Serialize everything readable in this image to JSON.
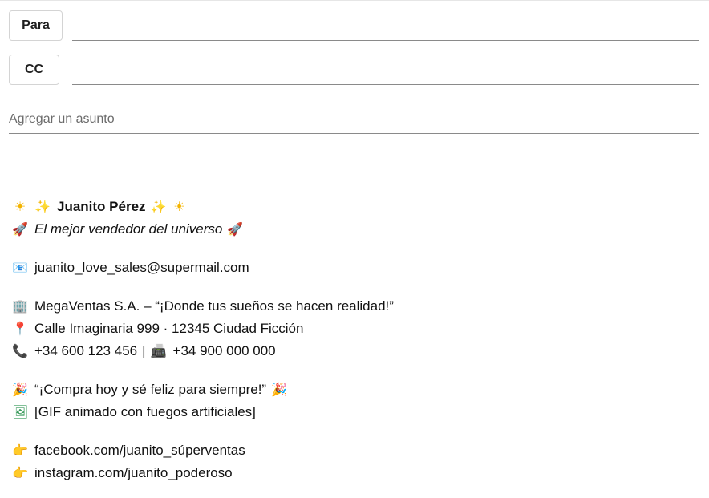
{
  "header": {
    "to_label": "Para",
    "cc_label": "CC",
    "to_value": "",
    "cc_value": "",
    "subject_placeholder": "Agregar un asunto",
    "subject_value": ""
  },
  "signature": {
    "name": "Juanito Pérez",
    "tagline": "El mejor vendedor del universo",
    "email": "juanito_love_sales@supermail.com",
    "company": "MegaVentas S.A. – “¡Donde tus sueños se hacen realidad!”",
    "address": "Calle Imaginaria 999 · 12345 Ciudad Ficción",
    "phone": "+34 600 123 456",
    "phone_separator": "|",
    "fax": "+34 900 000 000",
    "slogan": "“¡Compra hoy y sé feliz para siempre!”",
    "gif_placeholder": "[GIF animado con fuegos artificiales]",
    "facebook": "facebook.com/juanito_súperventas",
    "instagram": "instagram.com/juanito_poderoso"
  },
  "icons": {
    "sun": "☀",
    "sparkles": "✨",
    "rocket": "🚀",
    "email": "📧",
    "building": "🏢",
    "pin": "📍",
    "phone": "📞",
    "fax": "📠",
    "party": "🎉",
    "picture": "🖼",
    "pointing_hand": "👉"
  }
}
